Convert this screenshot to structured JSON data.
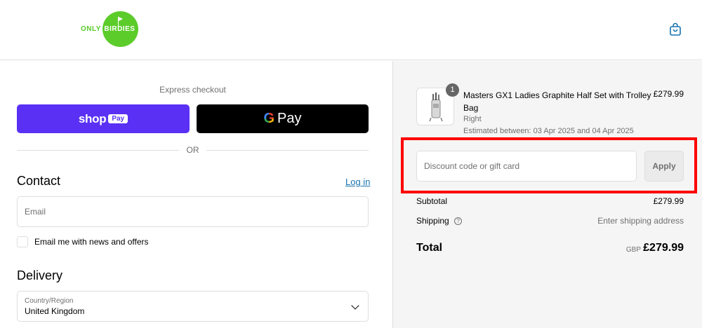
{
  "header": {
    "logo_left": "ONLY",
    "logo_right": "BIRDIES",
    "cart_icon": "shopping-bag-icon",
    "brand_color": "#5ccc2b"
  },
  "express": {
    "label": "Express checkout",
    "shop_label": "shop",
    "shop_pay_badge": "Pay",
    "gpay_g": "G",
    "gpay_label": "Pay",
    "or_label": "OR"
  },
  "contact": {
    "heading": "Contact",
    "login_link": "Log in",
    "email_placeholder": "Email",
    "newsletter_label": "Email me with news and offers"
  },
  "delivery": {
    "heading": "Delivery",
    "country_label": "Country/Region",
    "country_value": "United Kingdom"
  },
  "order": {
    "item": {
      "quantity": "1",
      "title": "Masters GX1 Ladies Graphite Half Set with Trolley Bag",
      "variant": "Right",
      "estimate": "Estimated between: 03 Apr 2025 and 04 Apr 2025",
      "price": "£279.99"
    },
    "discount_placeholder": "Discount code or gift card",
    "apply_label": "Apply",
    "subtotal_label": "Subtotal",
    "subtotal_value": "£279.99",
    "shipping_label": "Shipping",
    "shipping_help_icon": "question-circle-icon",
    "shipping_value": "Enter shipping address",
    "total_label": "Total",
    "total_currency": "GBP",
    "total_value": "£279.99"
  }
}
